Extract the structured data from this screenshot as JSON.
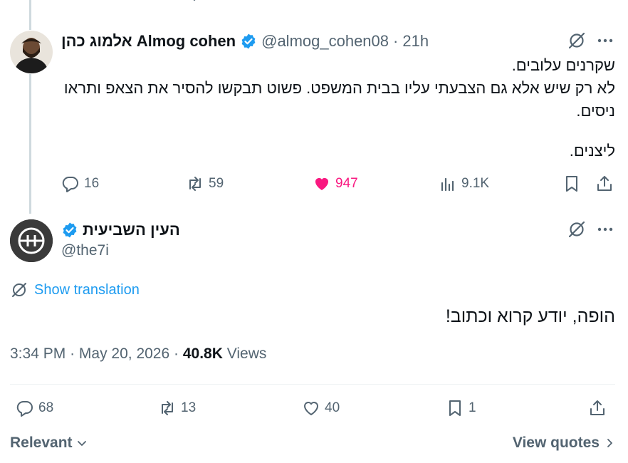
{
  "reply_tweet": {
    "author_name": "אלמוג כהן Almog cohen",
    "handle": "@almog_cohen08",
    "separator": "·",
    "time": "21h",
    "text_lines": [
      "שקרנים עלובים.",
      "לא רק שיש אלא גם הצבעתי עליו בבית המשפט. פשוט תבקשו להסיר את הצאפ ותראו ניסים.",
      "",
      "ליצנים."
    ],
    "stats": {
      "replies": "16",
      "reposts": "59",
      "likes": "947",
      "views": "9.1K"
    }
  },
  "main_tweet": {
    "author_name": "העין השביעית",
    "handle": "@the7i",
    "show_translation": "Show translation",
    "text": "הופה, יודע קרוא וכתוב!",
    "time": "3:34 PM",
    "date": "May 20, 2026",
    "views_count": "40.8K",
    "views_label": "Views",
    "separator": "·",
    "stats": {
      "replies": "68",
      "reposts": "13",
      "likes": "40",
      "bookmarks": "1"
    }
  },
  "footer": {
    "sort_label": "Relevant",
    "view_quotes": "View quotes"
  },
  "colors": {
    "accent": "#1d9bf0",
    "like_active": "#f91880",
    "muted": "#536471",
    "text": "#0f1419"
  }
}
